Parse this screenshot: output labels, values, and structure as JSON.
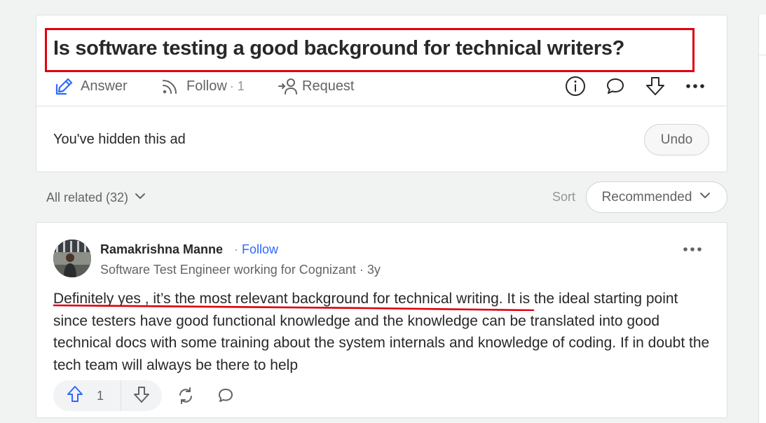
{
  "question": {
    "title": "Is software testing a good background for technical writers?",
    "actions": {
      "answer_label": "Answer",
      "follow_label": "Follow",
      "follow_count": "· 1",
      "request_label": "Request"
    },
    "icons": [
      "info-icon",
      "comment-icon",
      "downvote-icon",
      "more-icon"
    ]
  },
  "ad": {
    "hidden_text": "You've hidden this ad",
    "undo_label": "Undo"
  },
  "related": {
    "label": "All related (32)",
    "sort_label": "Sort",
    "sort_value": "Recommended"
  },
  "answer": {
    "author_name": "Ramakrishna Manne",
    "follow_sep": "·",
    "follow_label": "Follow",
    "author_credential": "Software Test Engineer working for Cognizant · 3y",
    "text": "Definitely yes , it’s the most relevant background for technical writing. It is the ideal starting point since testers have good functional knowledge and the knowledge can be translated into good technical docs with some training about the system internals and knowledge of coding. If in doubt the tech team will always be there to help",
    "upvote_count": "1"
  },
  "colors": {
    "accent_blue": "#2e69ff",
    "highlight_red": "#e0000d",
    "text_primary": "#282829",
    "text_secondary": "#636466",
    "page_background": "#f1f2f2"
  }
}
